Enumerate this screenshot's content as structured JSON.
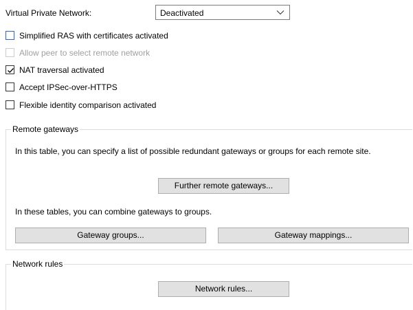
{
  "vpn": {
    "label": "Virtual Private Network:",
    "selected": "Deactivated",
    "chevron_icon": "chevron-down-icon"
  },
  "checkboxes": [
    {
      "label": "Simplified RAS with certificates activated",
      "checked": false,
      "enabled": true,
      "focused": true
    },
    {
      "label": "Allow peer to select remote network",
      "checked": false,
      "enabled": false,
      "focused": false
    },
    {
      "label": "NAT traversal activated",
      "checked": true,
      "enabled": true,
      "focused": false
    },
    {
      "label": "Accept IPSec-over-HTTPS",
      "checked": false,
      "enabled": true,
      "focused": false
    },
    {
      "label": "Flexible identity comparison activated",
      "checked": false,
      "enabled": true,
      "focused": false
    }
  ],
  "remote_gateways": {
    "title": "Remote gateways",
    "description": "In this table, you can specify a list of possible redundant gateways or groups for each remote site.",
    "further_button": "Further remote gateways...",
    "groups_description": "In these tables, you can combine gateways to groups.",
    "gateway_groups_button": "Gateway groups...",
    "gateway_mappings_button": "Gateway mappings..."
  },
  "network_rules": {
    "title": "Network rules",
    "button": "Network rules..."
  },
  "colors": {
    "button_bg": "#e1e1e1",
    "button_border": "#adadad",
    "focus_border": "#2e66c8",
    "disabled_text": "#a0a0a0",
    "group_border": "#dcdcdc"
  }
}
